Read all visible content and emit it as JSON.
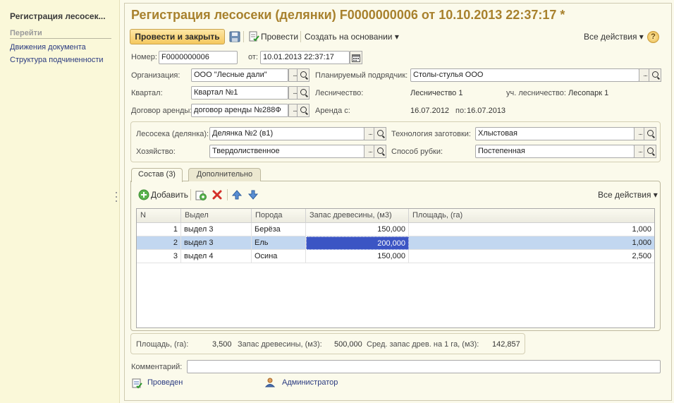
{
  "left_panel": {
    "title": "Регистрация лесосек...",
    "nav_header": "Перейти",
    "links": [
      "Движения документа",
      "Структура подчиненности"
    ]
  },
  "title": "Регистрация лесосеки (делянки) F0000000006 от 10.10.2013 22:37:17 *",
  "toolbar": {
    "post_close": "Провести и закрыть",
    "post": "Провести",
    "create_based": "Создать на основании",
    "all_actions": "Все действия",
    "help": "?"
  },
  "header": {
    "number_label": "Номер:",
    "number_value": "F0000000006",
    "date_label": "от:",
    "date_value": "10.01.2013 22:37:17",
    "org_label": "Организация:",
    "org_value": "ООО \"Лесные дали\"",
    "contractor_label": "Планируемый подрядчик:",
    "contractor_value": "Столы-стулья ООО",
    "quarter_label": "Квартал:",
    "quarter_value": "Квартал №1",
    "forestry_label": "Лесничество:",
    "forestry_value": "Лесничество 1",
    "district_label": "уч. лесничество:",
    "district_value": "Лесопарк 1",
    "contract_label": "Договор аренды:",
    "contract_value": "договор аренды №288Ф",
    "lease_label": "Аренда с:",
    "lease_from": "16.07.2012",
    "lease_to_label": "по:",
    "lease_to": "16.07.2013"
  },
  "group": {
    "plot_label": "Лесосека (делянка):",
    "plot_value": "Делянка №2 (в1)",
    "tech_label": "Технология заготовки:",
    "tech_value": "Хлыстовая",
    "farm_label": "Хозяйство:",
    "farm_value": "Твердолиственное",
    "cut_label": "Способ рубки:",
    "cut_value": "Постепенная"
  },
  "tabs": [
    "Состав (3)",
    "Дополнительно"
  ],
  "table_toolbar": {
    "add": "Добавить",
    "all_actions": "Все действия"
  },
  "table": {
    "columns": [
      "N",
      "Выдел",
      "Порода",
      "Запас древесины, (м3)",
      "Площадь, (га)"
    ],
    "rows": [
      {
        "n": "1",
        "vydel": "выдел 3",
        "poroda": "Берёза",
        "zapas": "150,000",
        "ploshad": "1,000"
      },
      {
        "n": "2",
        "vydel": "выдел 3",
        "poroda": "Ель",
        "zapas": "200,000",
        "ploshad": "1,000"
      },
      {
        "n": "3",
        "vydel": "выдел 4",
        "poroda": "Осина",
        "zapas": "150,000",
        "ploshad": "2,500"
      }
    ]
  },
  "summary": {
    "area_label": "Площадь, (га):",
    "area_value": "3,500",
    "stock_label": "Запас древесины, (м3):",
    "stock_value": "500,000",
    "avg_label": "Сред. запас древ. на 1 га, (м3):",
    "avg_value": "142,857"
  },
  "comment_label": "Комментарий:",
  "comment_value": "",
  "footer": {
    "status": "Проведен",
    "user": "Администратор"
  },
  "colors": {
    "title": "#a8812d",
    "selected_row": "#c2d7f0",
    "active_cell": "#3b55c4"
  }
}
